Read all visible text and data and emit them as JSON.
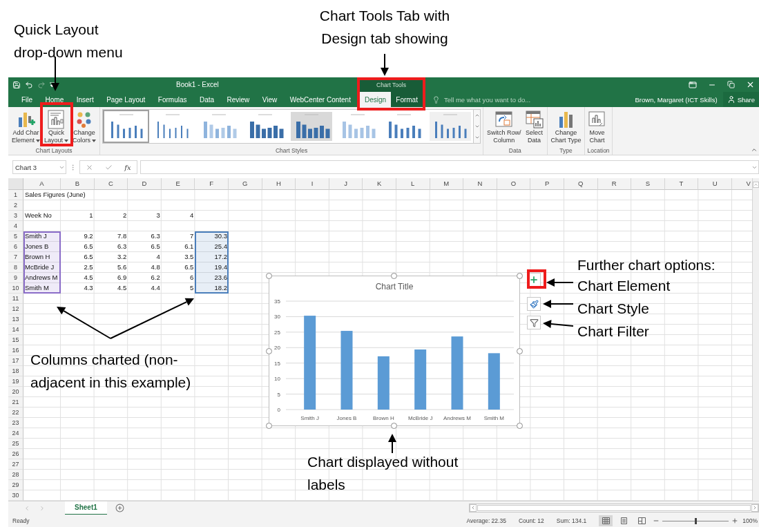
{
  "annotations": [
    {
      "lines": [
        "Chart Tools Tab with",
        "Design tab showing"
      ]
    },
    {
      "lines": [
        "Quick Layout",
        "drop-down menu"
      ]
    },
    {
      "lines": [
        "Further chart options:"
      ]
    },
    {
      "lines": [
        "Chart Element"
      ]
    },
    {
      "lines": [
        "Chart Style"
      ]
    },
    {
      "lines": [
        "Chart Filter"
      ]
    },
    {
      "lines": [
        "Columns charted (non-",
        "adjacent in this example)"
      ]
    },
    {
      "lines": [
        "Chart displayed without",
        "labels"
      ]
    }
  ],
  "window": {
    "title": "Book1 - Excel",
    "context_group": "Chart Tools",
    "user": "Brown, Margaret (ICT Skills)",
    "share": "Share"
  },
  "tabs": [
    {
      "label": "File",
      "selected": false,
      "contextual": false
    },
    {
      "label": "Home",
      "selected": false,
      "contextual": false
    },
    {
      "label": "Insert",
      "selected": false,
      "contextual": false
    },
    {
      "label": "Page Layout",
      "selected": false,
      "contextual": false
    },
    {
      "label": "Formulas",
      "selected": false,
      "contextual": false
    },
    {
      "label": "Data",
      "selected": false,
      "contextual": false
    },
    {
      "label": "Review",
      "selected": false,
      "contextual": false
    },
    {
      "label": "View",
      "selected": false,
      "contextual": false
    },
    {
      "label": "WebCenter Content",
      "selected": false,
      "contextual": false
    },
    {
      "label": "Design",
      "selected": true,
      "contextual": true
    },
    {
      "label": "Format",
      "selected": false,
      "contextual": true
    }
  ],
  "tell_me": {
    "placeholder": "Tell me what you want to do..."
  },
  "ribbon": {
    "groups": [
      {
        "label": "Chart Layouts",
        "kind": "buttons",
        "buttons": [
          {
            "lines": [
              "Add Char",
              "Element"
            ],
            "dropdown": true
          },
          {
            "lines": [
              "Quick",
              "Layout"
            ],
            "dropdown": true
          },
          {
            "lines": [
              "Change",
              "Colors"
            ],
            "dropdown": true
          }
        ]
      },
      {
        "label": "Chart Styles",
        "kind": "gallery",
        "styles": [
          {
            "selected": true
          },
          {
            "selected": false
          },
          {
            "selected": false
          },
          {
            "selected": false
          },
          {
            "selected": false
          },
          {
            "selected": false
          },
          {
            "selected": false
          },
          {
            "selected": false
          }
        ]
      },
      {
        "label": "Data",
        "kind": "buttons",
        "buttons": [
          {
            "lines": [
              "Switch Row/",
              "Column"
            ],
            "dropdown": false
          },
          {
            "lines": [
              "Select",
              "Data"
            ],
            "dropdown": false
          }
        ]
      },
      {
        "label": "Type",
        "kind": "buttons",
        "buttons": [
          {
            "lines": [
              "Change",
              "Chart Type"
            ],
            "dropdown": false
          }
        ]
      },
      {
        "label": "Location",
        "kind": "buttons",
        "buttons": [
          {
            "lines": [
              "Move",
              "Chart"
            ],
            "dropdown": false
          }
        ]
      }
    ]
  },
  "formula_bar": {
    "name_box": "Chart 3",
    "function_label": "fx"
  },
  "sheet": {
    "columns": [
      "A",
      "B",
      "C",
      "D",
      "E",
      "F",
      "G",
      "H",
      "I",
      "J",
      "K",
      "L",
      "M",
      "N",
      "O",
      "P",
      "Q",
      "R",
      "S",
      "T",
      "U",
      "V"
    ],
    "rows": [
      {
        "number": "1",
        "cells": [
          "Sales Figures (June)"
        ]
      },
      {
        "number": "2"
      },
      {
        "number": "3",
        "cells": [
          "Week No",
          "1",
          "2",
          "3",
          "4"
        ]
      },
      {
        "number": "4"
      },
      {
        "number": "5",
        "cells": [
          {
            "text": "Smith J",
            "color": "#8a6cc8"
          },
          "9.2",
          "7.8",
          "6.3",
          "7",
          {
            "text": "30.3",
            "color": "#4a7ebb"
          }
        ]
      },
      {
        "number": "6",
        "cells": [
          {
            "text": "Jones B",
            "color": "#8a6cc8"
          },
          "6.5",
          "6.3",
          "6.5",
          "6.1",
          {
            "text": "25.4",
            "color": "#4a7ebb"
          }
        ]
      },
      {
        "number": "7",
        "cells": [
          {
            "text": "Brown H",
            "color": "#8a6cc8"
          },
          "6.5",
          "3.2",
          "4",
          "3.5",
          {
            "text": "17.2",
            "color": "#4a7ebb"
          }
        ]
      },
      {
        "number": "8",
        "cells": [
          {
            "text": "McBride J",
            "color": "#8a6cc8"
          },
          "2.5",
          "5.6",
          "4.8",
          "6.5",
          {
            "text": "19.4",
            "color": "#4a7ebb"
          }
        ]
      },
      {
        "number": "9",
        "cells": [
          {
            "text": "Andrews M",
            "color": "#8a6cc8"
          },
          "4.5",
          "6.9",
          "6.2",
          "6",
          {
            "text": "23.6",
            "color": "#4a7ebb"
          }
        ]
      },
      {
        "number": "10",
        "cells": [
          {
            "text": "Smith M",
            "color": "#8a6cc8"
          },
          "4.3",
          "4.5",
          "4.4",
          "5",
          {
            "text": "18.2",
            "color": "#4a7ebb"
          }
        ]
      },
      {
        "number": "11"
      },
      {
        "number": "12"
      },
      {
        "number": "13"
      },
      {
        "number": "14"
      },
      {
        "number": "15"
      },
      {
        "number": "16"
      },
      {
        "number": "17"
      },
      {
        "number": "18"
      },
      {
        "number": "19"
      },
      {
        "number": "20"
      },
      {
        "number": "21"
      },
      {
        "number": "22"
      },
      {
        "number": "23"
      },
      {
        "number": "24"
      },
      {
        "number": "25"
      },
      {
        "number": "26"
      },
      {
        "number": "27"
      },
      {
        "number": "28"
      },
      {
        "number": "29"
      },
      {
        "number": "30"
      }
    ]
  },
  "chart": {
    "chart_data": {
      "type": "bar",
      "title": "Chart Title",
      "categories": [
        "Smith J",
        "Jones B",
        "Brown H",
        "McBride J",
        "Andrews M",
        "Smith M"
      ],
      "values": [
        30.3,
        25.4,
        17.2,
        19.4,
        23.6,
        18.2
      ],
      "ylim": [
        0,
        35
      ],
      "grid": true,
      "yticks": [
        0,
        5,
        10,
        15,
        20,
        25,
        30,
        35
      ]
    }
  },
  "sheet_tabs": [
    {
      "label": "Sheet1",
      "selected": true
    }
  ],
  "status": {
    "mode": "Ready",
    "stats": [
      "Average: 22.35",
      "Count: 12",
      "Sum: 134.1"
    ],
    "views": [
      {
        "selected": true
      },
      {
        "selected": false
      },
      {
        "selected": false
      }
    ],
    "zoom": {
      "level": 0.5,
      "reading": "100%"
    }
  }
}
